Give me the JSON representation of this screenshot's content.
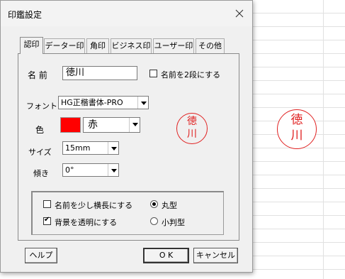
{
  "dialog": {
    "title": "印鑑設定",
    "close_icon": "close-icon"
  },
  "tabs": [
    {
      "label": "認印",
      "active": true
    },
    {
      "label": "データー印",
      "active": false
    },
    {
      "label": "角印",
      "active": false
    },
    {
      "label": "ビジネス印",
      "active": false
    },
    {
      "label": "ユーザー印",
      "active": false
    },
    {
      "label": "その他",
      "active": false
    }
  ],
  "form": {
    "name_label": "名 前",
    "name_value": "徳川",
    "two_line_label": "名前を2段にする",
    "two_line_checked": false,
    "font_label": "フォント",
    "font_value": "HG正楷書体-PRO",
    "color_label": "色",
    "color_swatch": "#ff0000",
    "color_value": "赤",
    "size_label": "サイズ",
    "size_value": "15mm",
    "tilt_label": "傾き",
    "tilt_value": "0°"
  },
  "options": {
    "stretch_label": "名前を少し横長にする",
    "stretch_checked": false,
    "transparent_label": "背景を透明にする",
    "transparent_checked": true,
    "round_label": "丸型",
    "round_checked": true,
    "oval_label": "小判型",
    "oval_checked": false
  },
  "buttons": {
    "help": "ヘルプ",
    "ok": "O K",
    "cancel": "キャンセル"
  },
  "preview": {
    "char1": "徳",
    "char2": "川",
    "stamp_color": "#e02020"
  },
  "sheet_stamp": {
    "char1": "徳",
    "char2": "川"
  }
}
